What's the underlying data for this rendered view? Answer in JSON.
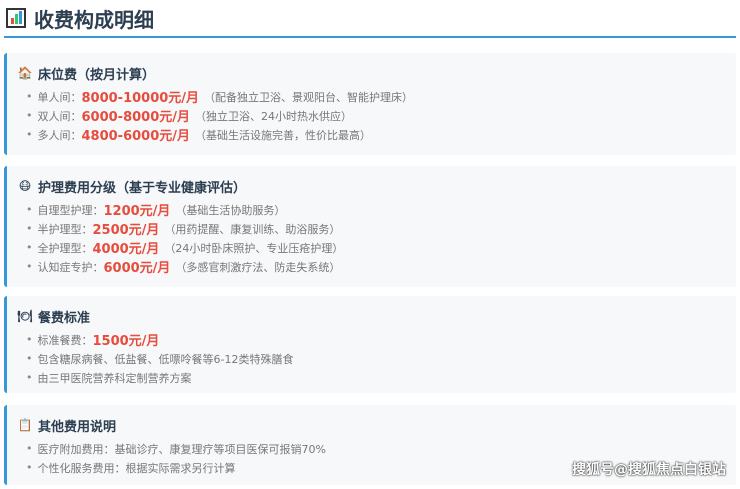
{
  "title": "收费构成明细",
  "sections": [
    {
      "heading": "床位费（按月计算）",
      "icon": "house-icon",
      "items": [
        {
          "label": "单人间：",
          "price": "8000-10000元/月",
          "note": "（配备独立卫浴、景观阳台、智能护理床）"
        },
        {
          "label": "双人间：",
          "price": "6000-8000元/月",
          "note": "（独立卫浴、24小时热水供应）"
        },
        {
          "label": "多人间：",
          "price": "4800-6000元/月",
          "note": "（基础生活设施完善，性价比最高）"
        }
      ]
    },
    {
      "heading": "护理费用分级（基于专业健康评估）",
      "icon": "face-mask-icon",
      "items": [
        {
          "label": "自理型护理：",
          "price": "1200元/月",
          "note": "（基础生活协助服务）"
        },
        {
          "label": "半护理型：",
          "price": "2500元/月",
          "note": "（用药提醒、康复训练、助浴服务）"
        },
        {
          "label": "全护理型：",
          "price": "4000元/月",
          "note": "（24小时卧床照护、专业压疮护理）"
        },
        {
          "label": "认知症专护：",
          "price": "6000元/月",
          "note": "（多感官刺激疗法、防走失系统）"
        }
      ]
    },
    {
      "heading": "餐费标准",
      "icon": "meal-icon",
      "items": [
        {
          "label": "标准餐费：",
          "price": "1500元/月",
          "note": ""
        },
        {
          "label": "包含糖尿病餐、低盐餐、低嘌呤餐等6-12类特殊膳食",
          "price": "",
          "note": ""
        },
        {
          "label": "由三甲医院营养科定制营养方案",
          "price": "",
          "note": ""
        }
      ]
    },
    {
      "heading": "其他费用说明",
      "icon": "clipboard-icon",
      "items": [
        {
          "label": "医疗附加费用：基础诊疗、康复理疗等项目医保可报销70%",
          "price": "",
          "note": ""
        },
        {
          "label": "个性化服务费用：根据实际需求另行计算",
          "price": "",
          "note": ""
        }
      ]
    }
  ],
  "watermark": "搜狐号@搜狐焦点白银站",
  "colors": {
    "accent": "#3498db",
    "price": "#e74c3c"
  }
}
